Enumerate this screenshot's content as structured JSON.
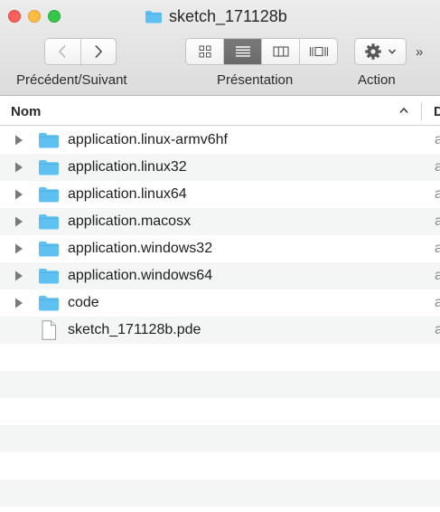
{
  "window": {
    "title": "sketch_171128b"
  },
  "toolbar": {
    "nav_label": "Précédent/Suivant",
    "view_label": "Présentation",
    "action_label": "Action",
    "overflow": "»"
  },
  "columns": {
    "name": "Nom",
    "next_header": "D"
  },
  "files": [
    {
      "name": "application.linux-armv6hf",
      "type": "folder",
      "expandable": true,
      "kind": "a"
    },
    {
      "name": "application.linux32",
      "type": "folder",
      "expandable": true,
      "kind": "a"
    },
    {
      "name": "application.linux64",
      "type": "folder",
      "expandable": true,
      "kind": "a"
    },
    {
      "name": "application.macosx",
      "type": "folder",
      "expandable": true,
      "kind": "a"
    },
    {
      "name": "application.windows32",
      "type": "folder",
      "expandable": true,
      "kind": "a"
    },
    {
      "name": "application.windows64",
      "type": "folder",
      "expandable": true,
      "kind": "a"
    },
    {
      "name": "code",
      "type": "folder",
      "expandable": true,
      "kind": "a"
    },
    {
      "name": "sketch_171128b.pde",
      "type": "file",
      "expandable": false,
      "kind": "a"
    }
  ],
  "colors": {
    "folder": "#5ec1f1",
    "active_view": "#6e6e6e",
    "stripe": "#f4f5f5"
  }
}
